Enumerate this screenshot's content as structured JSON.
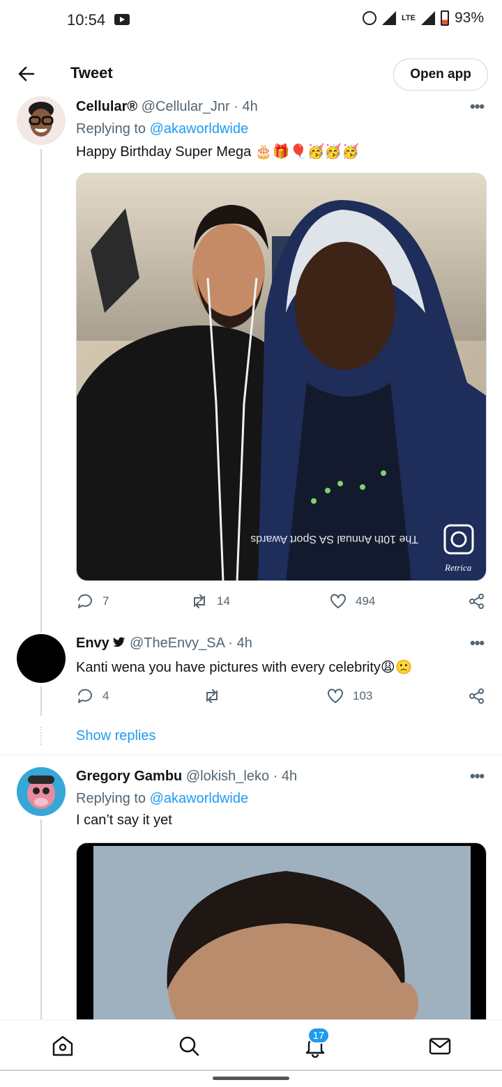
{
  "status_bar": {
    "time": "10:54",
    "network": "LTE",
    "battery": "93%"
  },
  "header": {
    "title": "Tweet",
    "open_app_label": "Open app"
  },
  "tweets": [
    {
      "name": "Cellular®",
      "handle": "@Cellular_Jnr · 4h",
      "replying_prefix": "Replying to",
      "replying_to": "@akaworldwide",
      "text": "Happy Birthday Super Mega",
      "emojis": "🎂🎁🎈🥳🥳🥳",
      "media_caption": "The 10th Annual SA Sport Awards",
      "media_watermark": "Retrica",
      "replies": "7",
      "retweets": "14",
      "likes": "494"
    },
    {
      "name": "Envy",
      "handle": "@TheEnvy_SA · 4h",
      "text": "Kanti wena you have pictures with every celebrity",
      "emojis": "😩🙁",
      "replies": "4",
      "retweets": "",
      "likes": "103",
      "show_replies": "Show replies"
    },
    {
      "name": "Gregory Gambu",
      "handle": "@lokish_leko · 4h",
      "replying_prefix": "Replying to",
      "replying_to": "@akaworldwide",
      "text": "I can’t say it yet"
    }
  ],
  "bottom_nav": {
    "notifications_badge": "17"
  },
  "colors": {
    "link": "#1d9bf0",
    "secondary_text": "#536471",
    "primary_text": "#0f1419"
  }
}
